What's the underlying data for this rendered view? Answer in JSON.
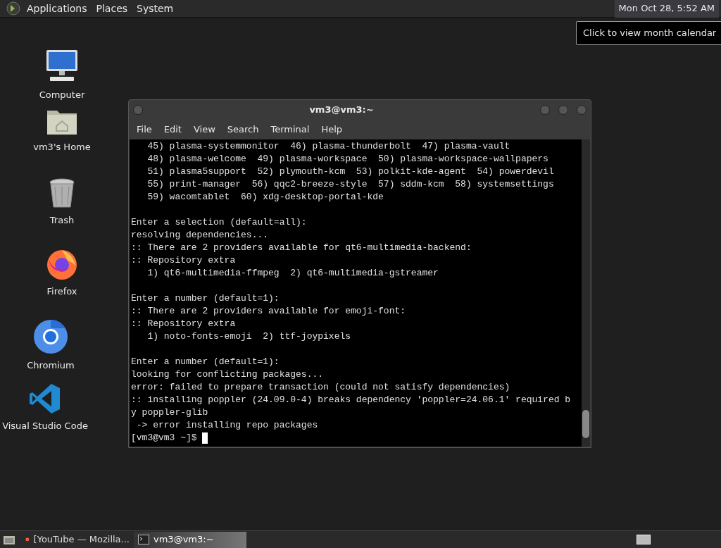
{
  "top_panel": {
    "menus": [
      "Applications",
      "Places",
      "System"
    ],
    "clock": "Mon Oct 28, 5:52 AM",
    "tooltip": "Click to view month calendar"
  },
  "desktop_icons": [
    {
      "kind": "computer",
      "label": "Computer"
    },
    {
      "kind": "home",
      "label": "vm3's Home"
    },
    {
      "kind": "trash",
      "label": "Trash"
    },
    {
      "kind": "firefox",
      "label": "Firefox"
    },
    {
      "kind": "chromium",
      "label": "Chromium"
    },
    {
      "kind": "vscode",
      "label": "Visual Studio Code"
    }
  ],
  "window": {
    "title": "vm3@vm3:~",
    "menu": [
      "File",
      "Edit",
      "View",
      "Search",
      "Terminal",
      "Help"
    ],
    "blocks": [
      [
        "   45) plasma-systemmonitor  46) plasma-thunderbolt  47) plasma-vault",
        "   48) plasma-welcome  49) plasma-workspace  50) plasma-workspace-wallpapers",
        "   51) plasma5support  52) plymouth-kcm  53) polkit-kde-agent  54) powerdevil",
        "   55) print-manager  56) qqc2-breeze-style  57) sddm-kcm  58) systemsettings",
        "   59) wacomtablet  60) xdg-desktop-portal-kde"
      ],
      [
        "Enter a selection (default=all):",
        "resolving dependencies...",
        ":: There are 2 providers available for qt6-multimedia-backend:",
        ":: Repository extra",
        "   1) qt6-multimedia-ffmpeg  2) qt6-multimedia-gstreamer"
      ],
      [
        "Enter a number (default=1):",
        ":: There are 2 providers available for emoji-font:",
        ":: Repository extra",
        "   1) noto-fonts-emoji  2) ttf-joypixels"
      ],
      [
        "Enter a number (default=1):",
        "looking for conflicting packages...",
        "error: failed to prepare transaction (could not satisfy dependencies)",
        ":: installing poppler (24.09.0-4) breaks dependency 'poppler=24.06.1' required b",
        "y poppler-glib",
        " -> error installing repo packages"
      ]
    ],
    "prompt": "[vm3@vm3 ~]$ "
  },
  "taskbar": {
    "tasks": [
      {
        "kind": "firefox",
        "label": "[YouTube — Mozilla...",
        "selected": false
      },
      {
        "kind": "terminal",
        "label": "vm3@vm3:~",
        "selected": true
      }
    ]
  }
}
